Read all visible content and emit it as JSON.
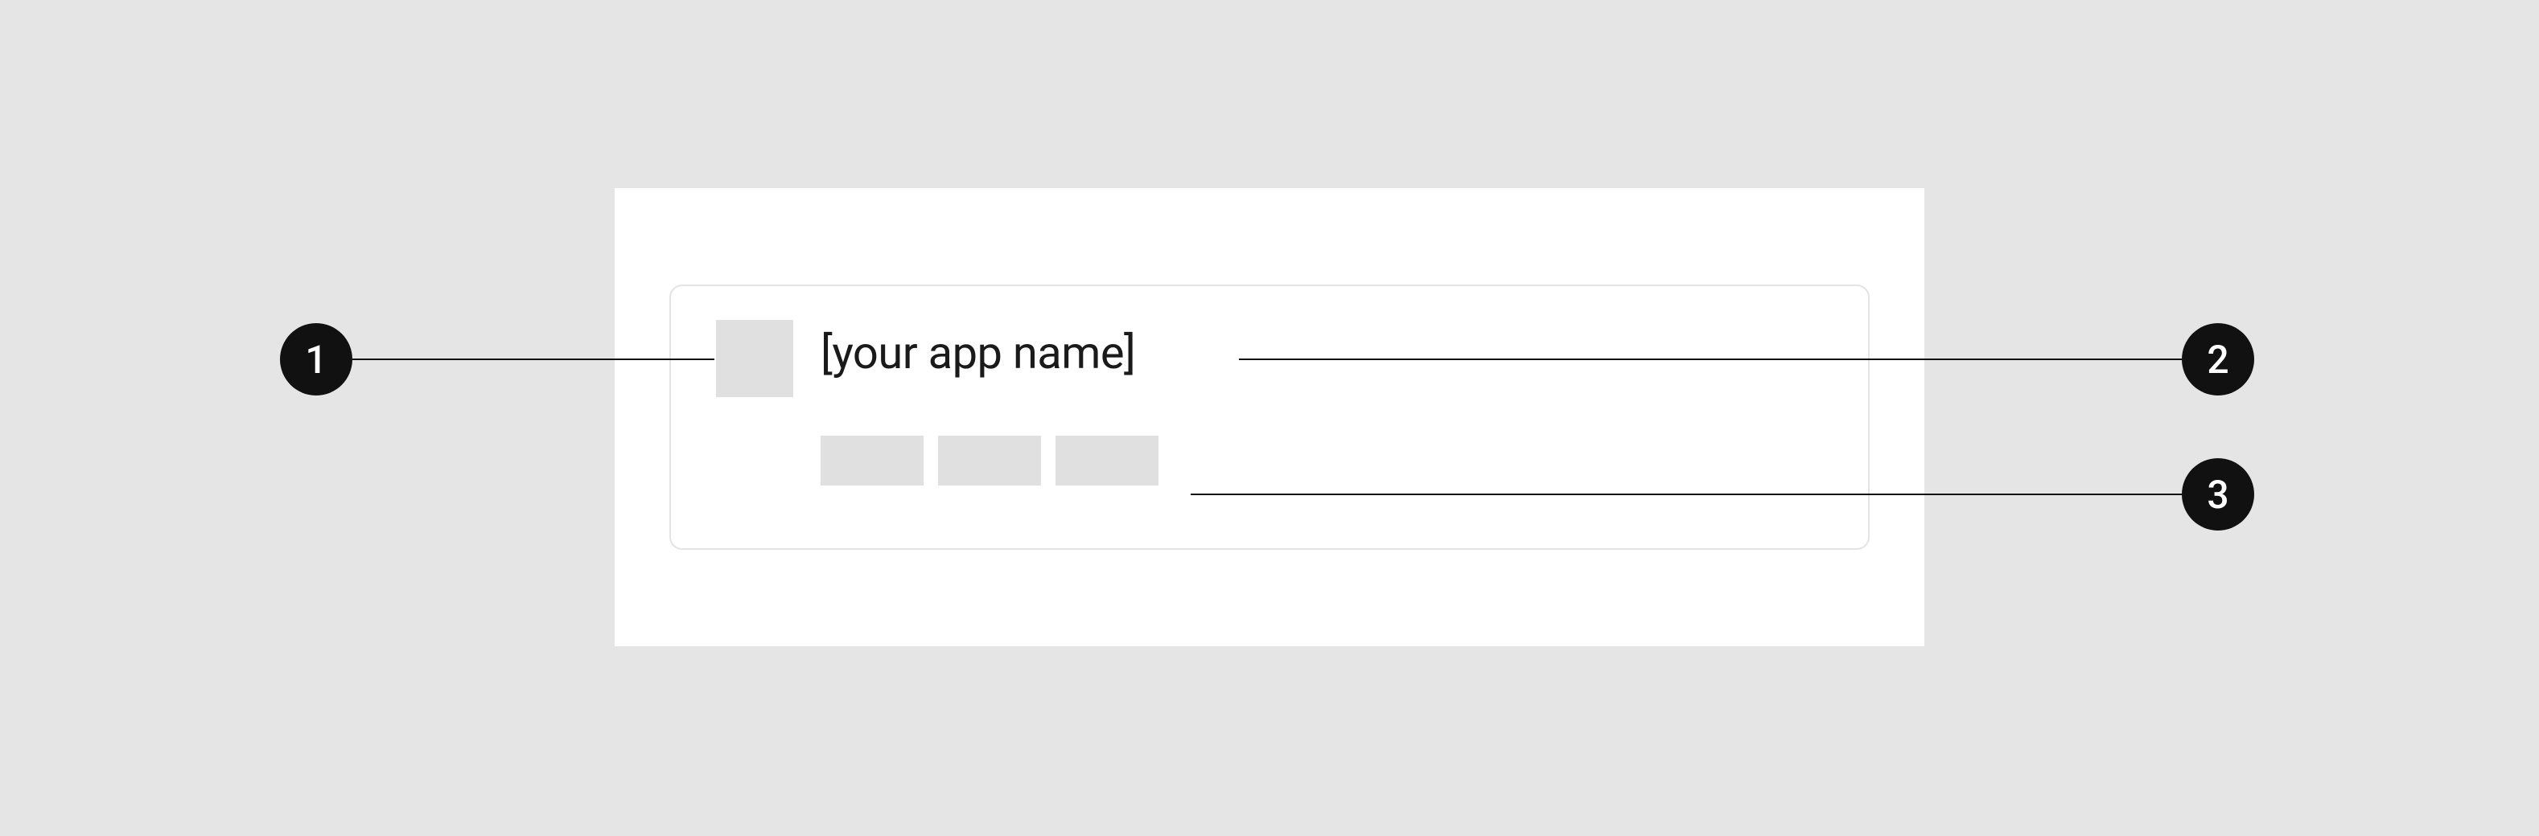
{
  "card": {
    "title": "[your app name]"
  },
  "callouts": {
    "one": "1",
    "two": "2",
    "three": "3"
  }
}
